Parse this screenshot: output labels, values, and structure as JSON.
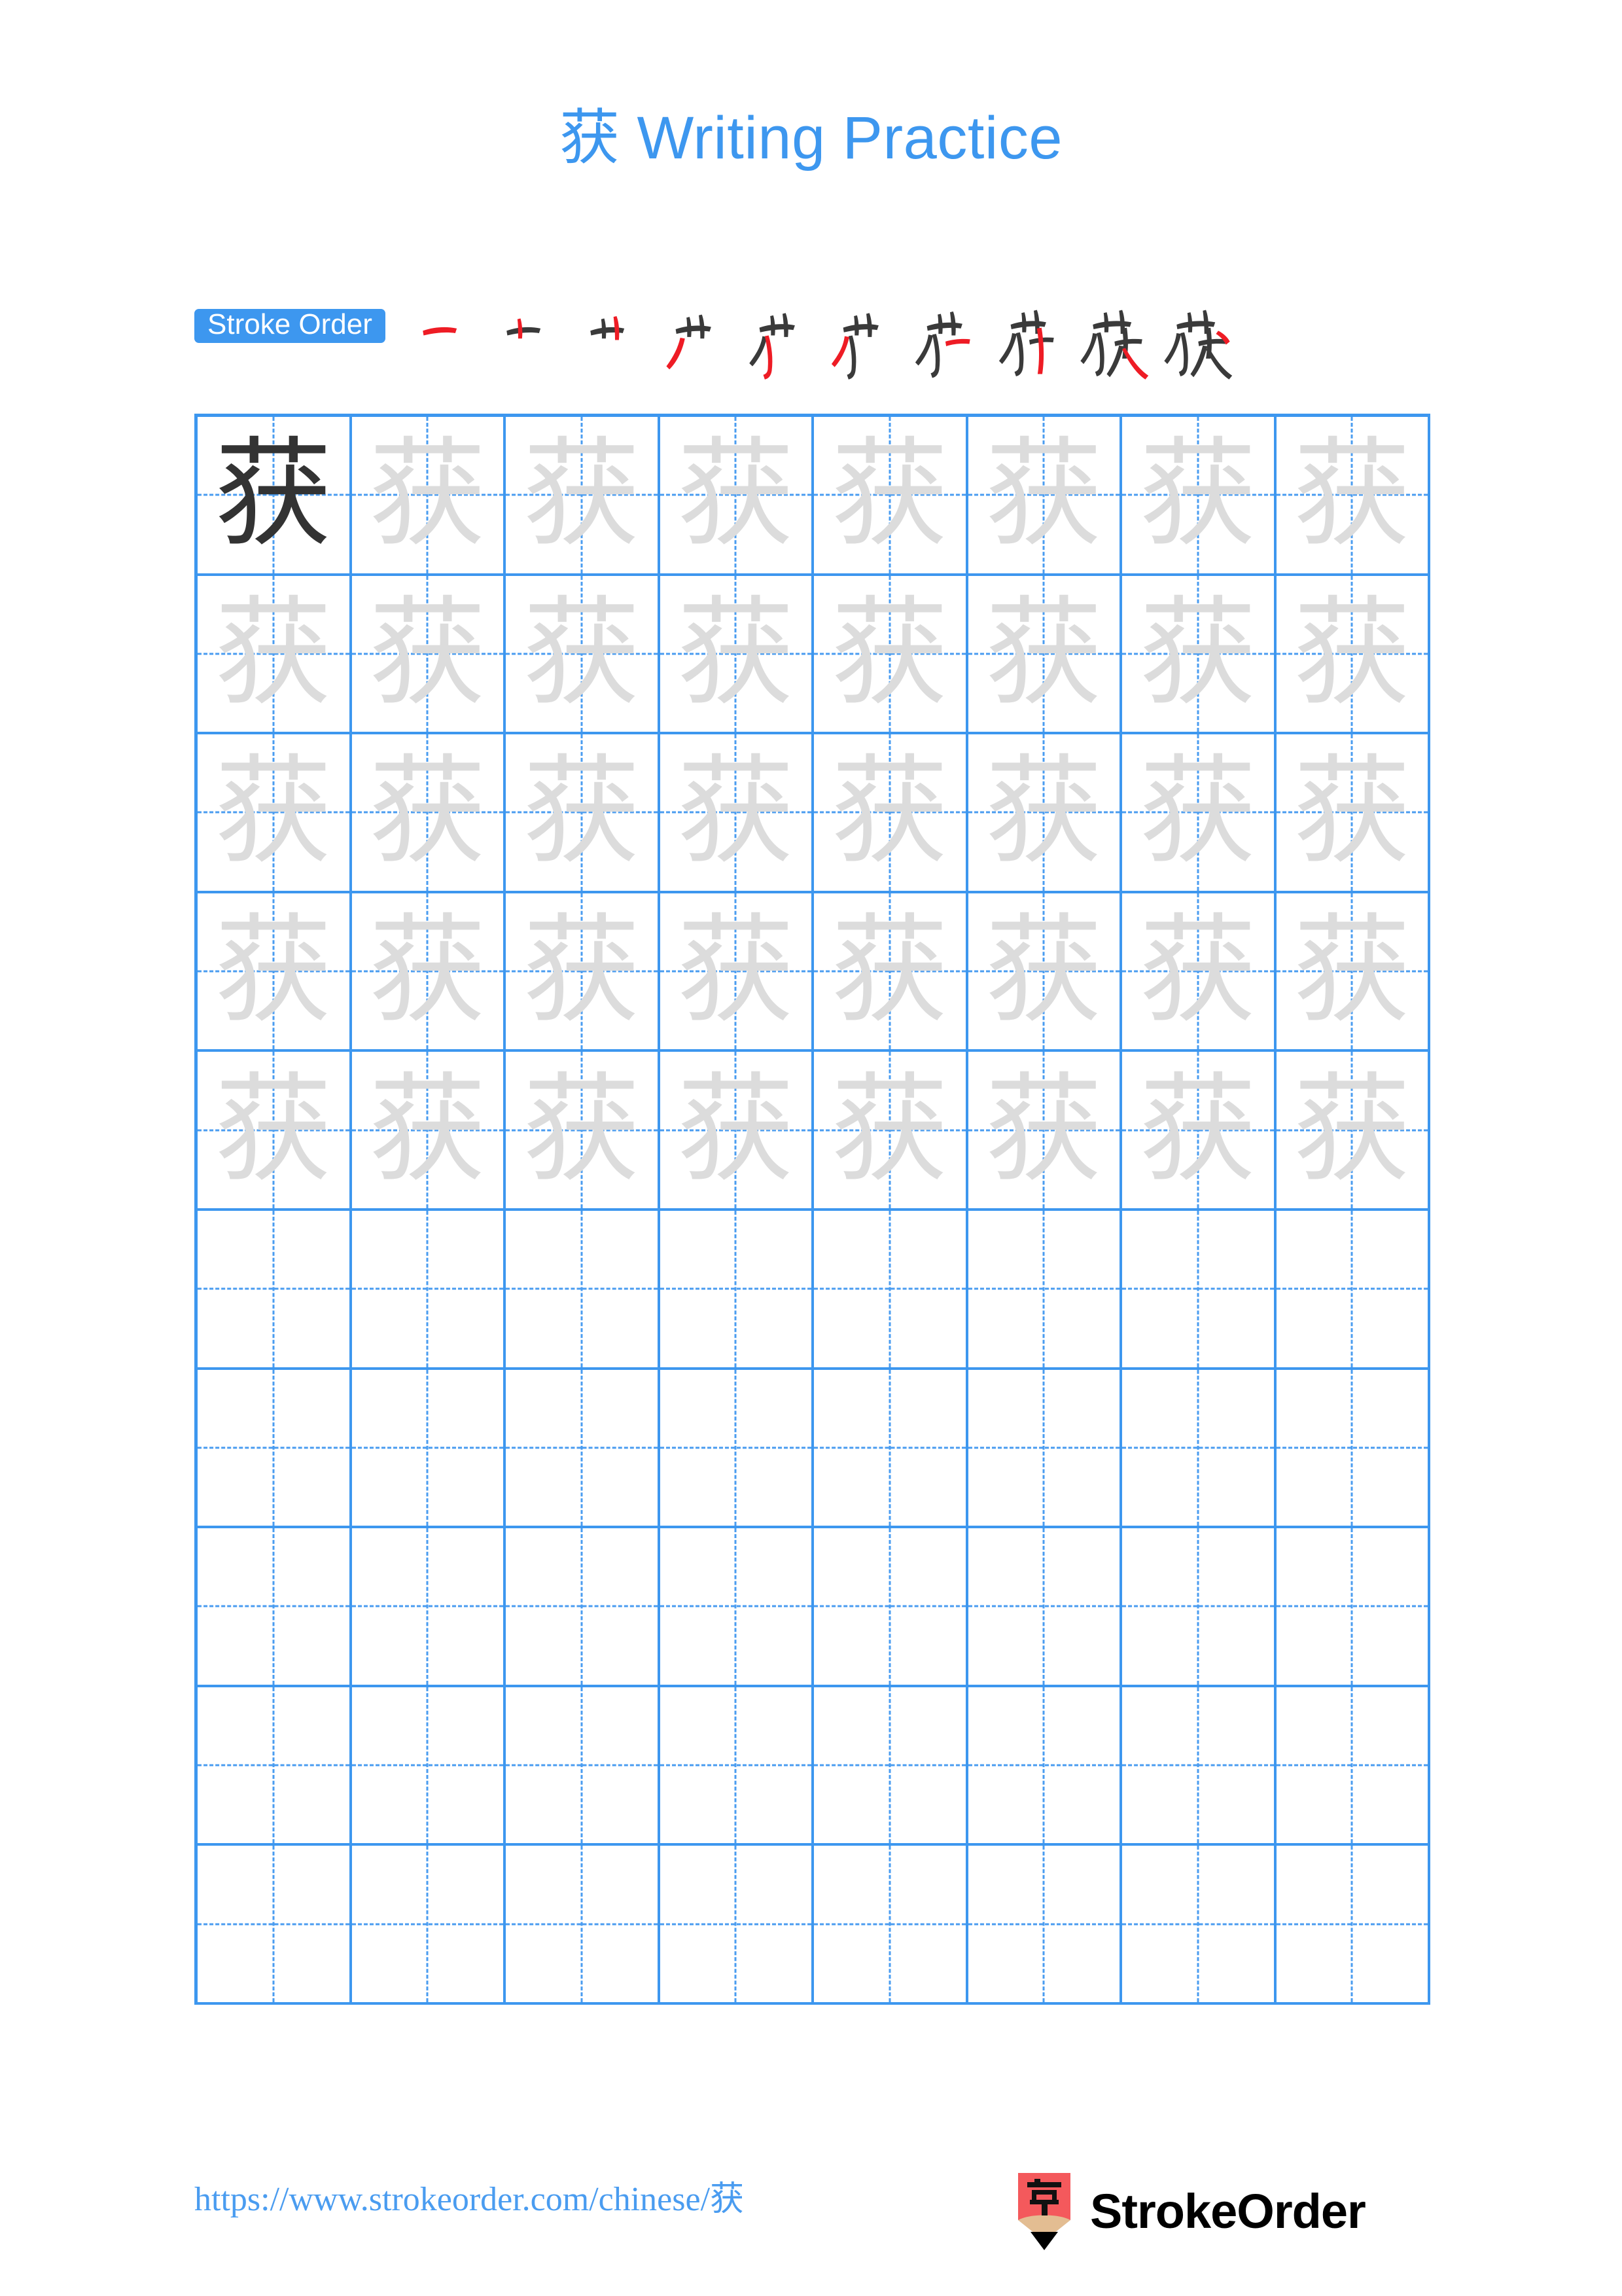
{
  "page": {
    "character": "获",
    "background_color": "#ffffff",
    "accent_color": "#3d97ef",
    "trace_color": "#dcdcdc",
    "dark_char_color": "#333333",
    "new_stroke_color": "#ee1c25"
  },
  "title": {
    "character": "获",
    "text": " Writing Practice",
    "full": "获 Writing Practice",
    "color": "#3d97ef"
  },
  "stroke_order": {
    "badge_label": "Stroke Order",
    "badge_bg": "#3d97ef",
    "badge_text_color": "#ffffff",
    "stroke_count": 10,
    "steps": [
      {
        "index": 1,
        "label": "stroke-1",
        "partial": "一"
      },
      {
        "index": 2,
        "label": "stroke-2",
        "partial": "十"
      },
      {
        "index": 3,
        "label": "stroke-3",
        "partial": "艹"
      },
      {
        "index": 4,
        "label": "stroke-4",
        "partial": "艹丿"
      },
      {
        "index": 5,
        "label": "stroke-5",
        "partial": "艹犭"
      },
      {
        "index": 6,
        "label": "stroke-6",
        "partial": "艹犭"
      },
      {
        "index": 7,
        "label": "stroke-7",
        "partial": "艹犭一"
      },
      {
        "index": 8,
        "label": "stroke-8",
        "partial": "艹犭丿"
      },
      {
        "index": 9,
        "label": "stroke-9",
        "partial": "获"
      },
      {
        "index": 10,
        "label": "stroke-10",
        "partial": "获"
      }
    ]
  },
  "grid": {
    "columns": 8,
    "rows": 10,
    "line_color": "#3d97ef",
    "guide_color": "#4a9cf0",
    "rows_data": [
      [
        "dark",
        "trace",
        "trace",
        "trace",
        "trace",
        "trace",
        "trace",
        "trace"
      ],
      [
        "trace",
        "trace",
        "trace",
        "trace",
        "trace",
        "trace",
        "trace",
        "trace"
      ],
      [
        "trace",
        "trace",
        "trace",
        "trace",
        "trace",
        "trace",
        "trace",
        "trace"
      ],
      [
        "trace",
        "trace",
        "trace",
        "trace",
        "trace",
        "trace",
        "trace",
        "trace"
      ],
      [
        "trace",
        "trace",
        "trace",
        "trace",
        "trace",
        "trace",
        "trace",
        "trace"
      ],
      [
        "blank",
        "blank",
        "blank",
        "blank",
        "blank",
        "blank",
        "blank",
        "blank"
      ],
      [
        "blank",
        "blank",
        "blank",
        "blank",
        "blank",
        "blank",
        "blank",
        "blank"
      ],
      [
        "blank",
        "blank",
        "blank",
        "blank",
        "blank",
        "blank",
        "blank",
        "blank"
      ],
      [
        "blank",
        "blank",
        "blank",
        "blank",
        "blank",
        "blank",
        "blank",
        "blank"
      ],
      [
        "blank",
        "blank",
        "blank",
        "blank",
        "blank",
        "blank",
        "blank",
        "blank"
      ]
    ]
  },
  "footer": {
    "url": "https://www.strokeorder.com/chinese/获",
    "url_color": "#4a9cf0",
    "brand_name": "StrokeOrder",
    "logo_character": "字",
    "logo_body_color": "#f4595c",
    "logo_wood_color": "#e3bd92",
    "logo_tip_color": "#000000"
  }
}
